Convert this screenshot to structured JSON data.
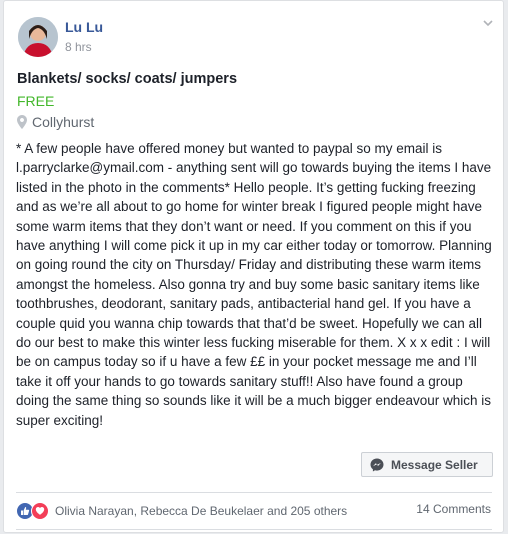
{
  "post": {
    "author": "Lu Lu",
    "time": "8 hrs",
    "title": "Blankets/ socks/ coats/ jumpers",
    "price": "FREE",
    "location": "Collyhurst",
    "body": "* A few people have offered money but wanted to paypal so my email is l.parryclarke@ymail.com - anything sent will go towards buying the items I have listed in the photo in the comments* Hello people. It’s getting fucking freezing and as we’re all about to go home for winter break I figured people might have some warm items that they don’t want or need. If you comment on this if you have anything I will come pick it up in my car either today or tomorrow. Planning on going round the city on Thursday/ Friday and distributing these warm items amongst the homeless. Also gonna try and buy some basic sanitary items like toothbrushes, deodorant, sanitary pads, antibacterial hand gel. If you have a couple quid you wanna chip towards that that’d be sweet. Hopefully we can all do our best to make this winter less fucking miserable for them. X x x edit : I will be on campus today so if u have a few ££ in your pocket message me and I’ll take it off your hands to go towards sanitary stuff!! Also have found a group doing the same thing so sounds like it will be a much bigger endeavour which is super exciting!",
    "message_button": "Message Seller",
    "reactions_text": "Olivia Narayan, Rebecca De Beukelaer and 205 others",
    "comments_text": "14 Comments"
  },
  "colors": {
    "link": "#385898",
    "price": "#42b72a",
    "like": "#4267b2",
    "love": "#f33e58"
  },
  "icons": [
    "avatar-photo",
    "chevron-down-icon",
    "location-pin-icon",
    "messenger-icon",
    "like-reaction-icon",
    "love-reaction-icon"
  ]
}
